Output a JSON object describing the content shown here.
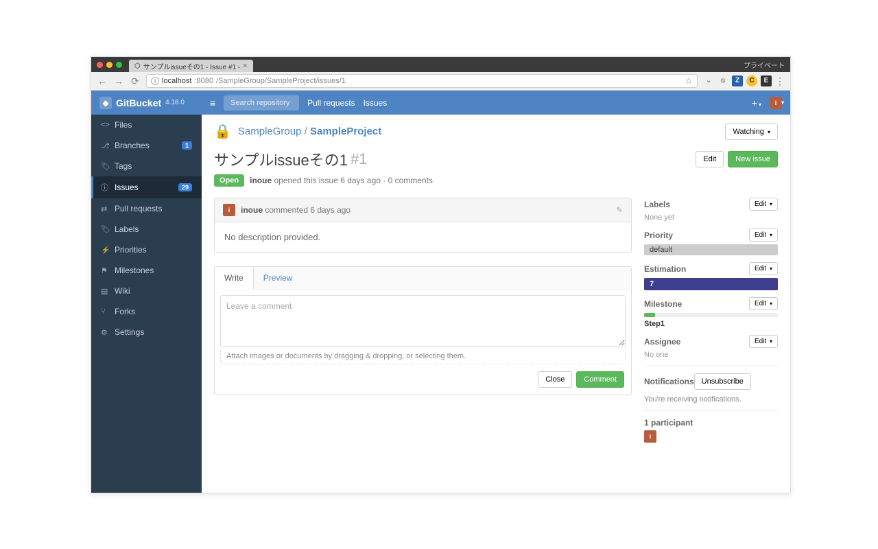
{
  "browser": {
    "tab_title": "サンプルissueその1 - Issue #1 - ",
    "private_label": "プライベート",
    "url_host": "localhost",
    "url_port": ":8080",
    "url_path": "/SampleGroup/SampleProject/issues/1"
  },
  "header": {
    "brand": "GitBucket",
    "version": "4.18.0",
    "search_placeholder": "Search repository",
    "pull_requests": "Pull requests",
    "issues": "Issues"
  },
  "sidebar": {
    "items": [
      {
        "icon": "<>",
        "label": "Files"
      },
      {
        "icon": "⎇",
        "label": "Branches",
        "badge": "1"
      },
      {
        "icon": "🏷",
        "label": "Tags"
      },
      {
        "icon": "ⓘ",
        "label": "Issues",
        "badge": "29",
        "active": true
      },
      {
        "icon": "⇄",
        "label": "Pull requests"
      },
      {
        "icon": "🏷",
        "label": "Labels"
      },
      {
        "icon": "⚡",
        "label": "Priorities"
      },
      {
        "icon": "⚑",
        "label": "Milestones"
      },
      {
        "icon": "▤",
        "label": "Wiki"
      },
      {
        "icon": "⑂",
        "label": "Forks"
      },
      {
        "icon": "⚙",
        "label": "Settings"
      }
    ]
  },
  "repo": {
    "group": "SampleGroup",
    "project": "SampleProject",
    "watching": "Watching"
  },
  "issue": {
    "title": "サンプルissueその1",
    "number": "#1",
    "edit_btn": "Edit",
    "new_btn": "New issue",
    "state": "Open",
    "author": "inoue",
    "meta_text": "opened this issue 6 days ago · 0 comments"
  },
  "comment": {
    "author": "inoue",
    "time": "commented 6 days ago",
    "body": "No description provided."
  },
  "editor": {
    "write_tab": "Write",
    "preview_tab": "Preview",
    "placeholder": "Leave a comment",
    "attach_hint": "Attach images or documents by dragging & dropping, or selecting them.",
    "close_btn": "Close",
    "comment_btn": "Comment"
  },
  "meta": {
    "labels": {
      "title": "Labels",
      "edit": "Edit",
      "none": "None yet"
    },
    "priority": {
      "title": "Priority",
      "edit": "Edit",
      "value": "default"
    },
    "estimation": {
      "title": "Estimation",
      "edit": "Edit",
      "value": "7"
    },
    "milestone": {
      "title": "Milestone",
      "edit": "Edit",
      "value": "Step1"
    },
    "assignee": {
      "title": "Assignee",
      "edit": "Edit",
      "none": "No one"
    },
    "notifications": {
      "title": "Notifications",
      "unsubscribe": "Unsubscribe",
      "text": "You're receiving notifications."
    },
    "participants": "1 participant"
  }
}
